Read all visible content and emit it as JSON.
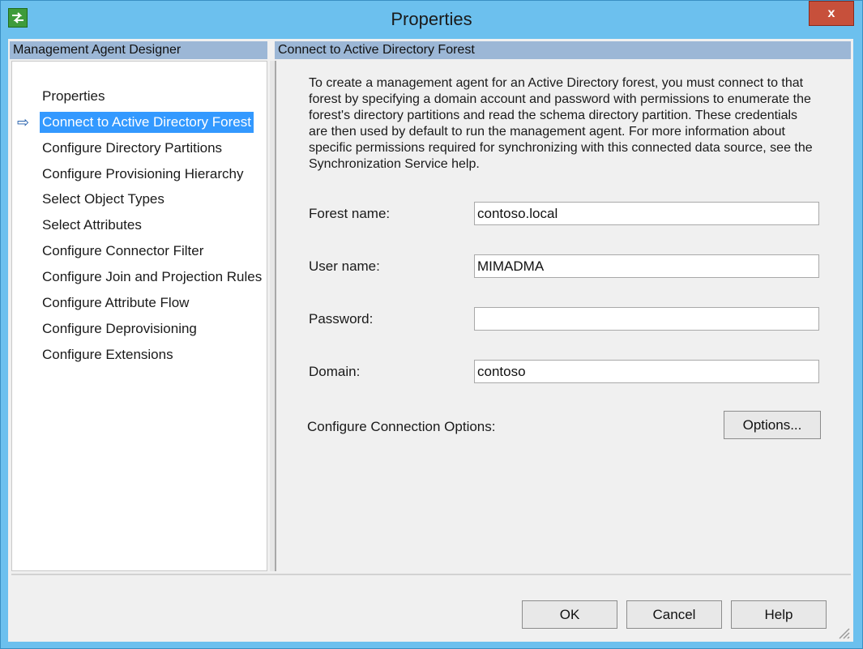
{
  "window": {
    "title": "Properties",
    "close_label": "x"
  },
  "left_panel": {
    "header": "Management Agent Designer",
    "items": [
      {
        "label": "Properties"
      },
      {
        "label": "Connect to Active Directory Forest",
        "selected": true
      },
      {
        "label": "Configure Directory Partitions"
      },
      {
        "label": "Configure Provisioning Hierarchy"
      },
      {
        "label": "Select Object Types"
      },
      {
        "label": "Select Attributes"
      },
      {
        "label": "Configure Connector Filter"
      },
      {
        "label": "Configure Join and Projection Rules"
      },
      {
        "label": "Configure Attribute Flow"
      },
      {
        "label": "Configure Deprovisioning"
      },
      {
        "label": "Configure Extensions"
      }
    ],
    "current_indicator": "⇨"
  },
  "right_panel": {
    "header": "Connect to Active Directory Forest",
    "description": "To create a management agent for an Active Directory forest, you must connect to that forest by specifying a domain account and password with permissions to enumerate the forest's directory partitions and read the schema directory partition. These credentials are then used by default to run the management agent. For more information about specific permissions required for synchronizing with this connected data source, see the Synchronization Service help.",
    "fields": {
      "forest": {
        "label": "Forest name:",
        "value": "contoso.local"
      },
      "user": {
        "label": "User name:",
        "value": "MIMADMA"
      },
      "password": {
        "label": "Password:",
        "value": ""
      },
      "domain": {
        "label": "Domain:",
        "value": "contoso"
      }
    },
    "connection_options": {
      "label": "Configure Connection Options:",
      "button": "Options..."
    }
  },
  "footer": {
    "ok": "OK",
    "cancel": "Cancel",
    "help": "Help"
  },
  "colors": {
    "frame": "#6cc0ee",
    "header_band": "#9cb7d6",
    "selection": "#3399ff",
    "close": "#c7503b"
  }
}
